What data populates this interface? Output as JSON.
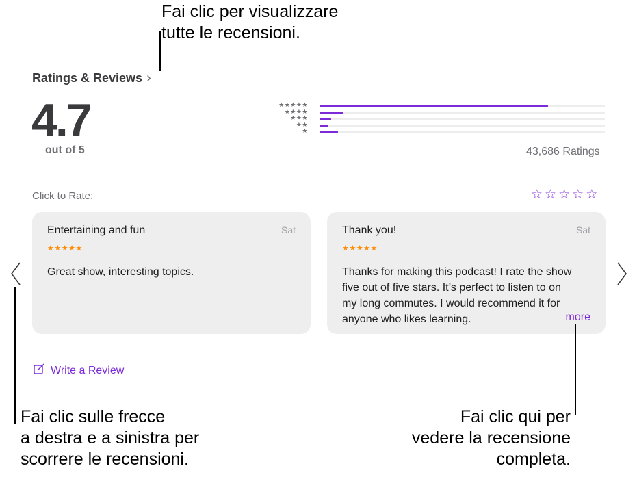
{
  "callouts": {
    "top": [
      "Fai clic per visualizzare",
      "tutte le recensioni."
    ],
    "left": [
      "Fai clic sulle frecce",
      "a destra e a sinistra per",
      "scorrere le recensioni."
    ],
    "right": [
      "Fai clic qui per",
      "vedere la recensione",
      "completa."
    ]
  },
  "ratings": {
    "title": "Ratings & Reviews",
    "score": "4.7",
    "score_sub": "out of 5",
    "count_label": "43,686 Ratings",
    "distribution": [
      {
        "stars": "★★★★★",
        "fraction": 0.8
      },
      {
        "stars": "★★★★",
        "fraction": 0.085
      },
      {
        "stars": "★★★",
        "fraction": 0.04
      },
      {
        "stars": "★★",
        "fraction": 0.03
      },
      {
        "stars": "★",
        "fraction": 0.065
      }
    ]
  },
  "rate": {
    "label": "Click to Rate:",
    "star_glyph": "☆"
  },
  "reviews": [
    {
      "title": "Entertaining and fun",
      "date": "Sat",
      "stars": "★★★★★",
      "body": "Great show, interesting topics."
    },
    {
      "title": "Thank you!",
      "date": "Sat",
      "stars": "★★★★★",
      "body": "Thanks for making this podcast! I rate the show five out of five stars. It’s perfect to listen to on my long commutes. I would recommend it for anyone who likes learning.",
      "more_label": "more"
    }
  ],
  "write_review": {
    "label": "Write a Review",
    "icon": "compose-icon"
  },
  "colors": {
    "accent": "#7c2bd9",
    "review_stars": "#ff8a00"
  }
}
